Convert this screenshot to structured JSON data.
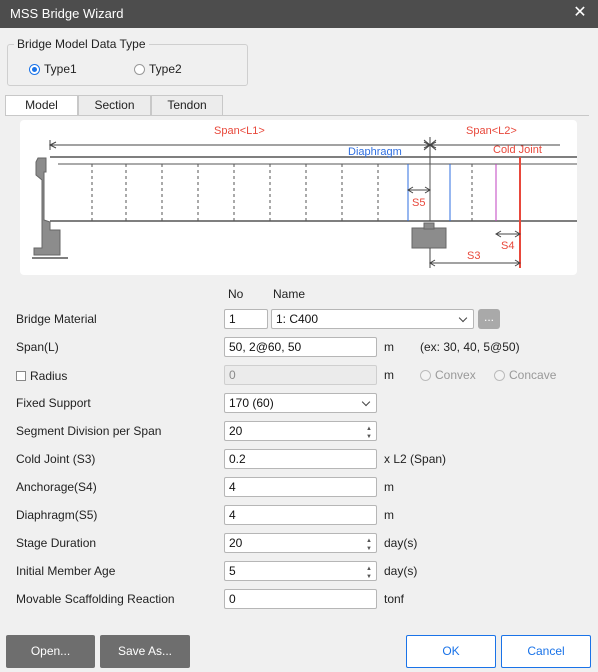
{
  "window": {
    "title": "MSS Bridge Wizard",
    "close_glyph": "✕"
  },
  "data_type": {
    "label": "Bridge Model Data Type",
    "options": [
      {
        "label": "Type1",
        "selected": true
      },
      {
        "label": "Type2",
        "selected": false
      }
    ]
  },
  "tabs": [
    {
      "label": "Model",
      "active": true
    },
    {
      "label": "Section",
      "active": false
    },
    {
      "label": "Tendon",
      "active": false
    }
  ],
  "diagram": {
    "span1": "Span<L1>",
    "span2": "Span<L2>",
    "diaphragm": "Diaphragm",
    "cold_joint": "Cold Joint",
    "s5": "S5",
    "s4": "S4",
    "s3": "S3"
  },
  "columns": {
    "no": "No",
    "name": "Name"
  },
  "form": {
    "bridge_material": {
      "label": "Bridge Material",
      "no": "1",
      "name": "1: C400",
      "more": "..."
    },
    "span": {
      "label": "Span(L)",
      "value": "50, 2@60, 50",
      "unit": "m",
      "hint": "(ex: 30, 40, 5@50)"
    },
    "radius": {
      "label": "Radius",
      "value": "0",
      "unit": "m",
      "convex": "Convex",
      "concave": "Concave"
    },
    "fixed_support": {
      "label": "Fixed Support",
      "value": "170 (60)"
    },
    "segment_division": {
      "label": "Segment Division per Span",
      "value": "20"
    },
    "cold_joint": {
      "label": "Cold Joint (S3)",
      "value": "0.2",
      "unit": "x L2 (Span)"
    },
    "anchorage": {
      "label": "Anchorage(S4)",
      "value": "4",
      "unit": "m"
    },
    "diaphragm": {
      "label": "Diaphragm(S5)",
      "value": "4",
      "unit": "m"
    },
    "stage_duration": {
      "label": "Stage Duration",
      "value": "20",
      "unit": "day(s)"
    },
    "initial_member_age": {
      "label": "Initial Member Age",
      "value": "5",
      "unit": "day(s)"
    },
    "movable_scaffolding": {
      "label": "Movable Scaffolding Reaction",
      "value": "0",
      "unit": "tonf"
    }
  },
  "buttons": {
    "open": "Open...",
    "save_as": "Save As...",
    "ok": "OK",
    "cancel": "Cancel"
  },
  "colors": {
    "accent": "#1a73e8",
    "red": "#e8483b",
    "blue": "#2f6fe0",
    "magenta": "#c040c0",
    "titlebar": "#4d4d4d"
  }
}
